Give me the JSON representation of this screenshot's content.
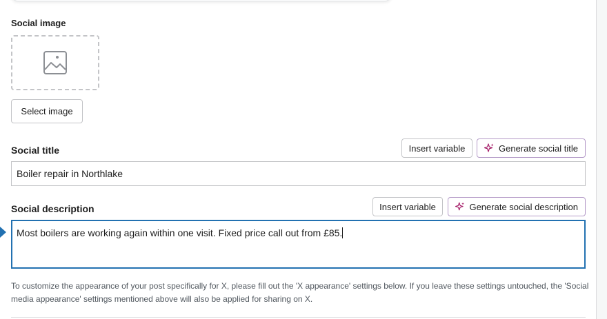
{
  "social_image": {
    "label": "Social image",
    "placeholder_icon": "image-placeholder-icon",
    "select_button": "Select image"
  },
  "social_title": {
    "label": "Social title",
    "insert_variable": "Insert variable",
    "generate_button": "Generate social title",
    "value": "Boiler repair in Northlake"
  },
  "social_description": {
    "label": "Social description",
    "insert_variable": "Insert variable",
    "generate_button": "Generate social description",
    "value": "Most boilers are working again within one visit. Fixed price call out from £85."
  },
  "help_text": "To customize the appearance of your post specifically for X, please fill out the 'X appearance' settings below. If you leave these settings untouched, the 'Social media appearance' settings mentioned above will also be applied for sharing on X.",
  "colors": {
    "focus": "#2271b1",
    "ai_sparkle": "#a61e69",
    "ai_border": "#b49ac8"
  }
}
